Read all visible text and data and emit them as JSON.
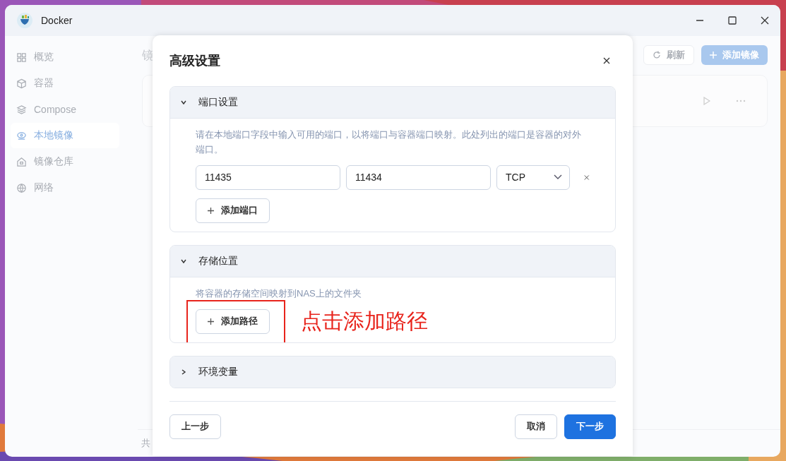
{
  "window": {
    "title": "Docker"
  },
  "sidebar": {
    "items": [
      {
        "label": "概览",
        "selected": false
      },
      {
        "label": "容器",
        "selected": false
      },
      {
        "label": "Compose",
        "selected": false
      },
      {
        "label": "本地镜像",
        "selected": true
      },
      {
        "label": "镜像仓库",
        "selected": false
      },
      {
        "label": "网络",
        "selected": false
      }
    ]
  },
  "page": {
    "title": "镜",
    "buttons": [
      {
        "label": "刷新",
        "kind": "refresh"
      },
      {
        "label": "添加镜像",
        "kind": "add"
      }
    ],
    "footer": "共"
  },
  "dialog": {
    "title": "高级设置",
    "sections": [
      {
        "kind": "ports",
        "title": "端口设置",
        "expanded": true,
        "description": "请在本地端口字段中输入可用的端口，以将端口与容器端口映射。此处列出的端口是容器的对外端口。",
        "ports": [
          {
            "local": "11435",
            "container": "11434",
            "protocol": "TCP"
          }
        ],
        "add_button": "添加端口"
      },
      {
        "kind": "storage",
        "title": "存储位置",
        "expanded": true,
        "description": "将容器的存储空间映射到NAS上的文件夹",
        "add_button": "添加路径",
        "annotation": "点击添加路径"
      },
      {
        "kind": "env",
        "title": "环境变量",
        "expanded": false
      }
    ],
    "buttons": {
      "back": "上一步",
      "cancel": "取消",
      "next": "下一步"
    }
  }
}
